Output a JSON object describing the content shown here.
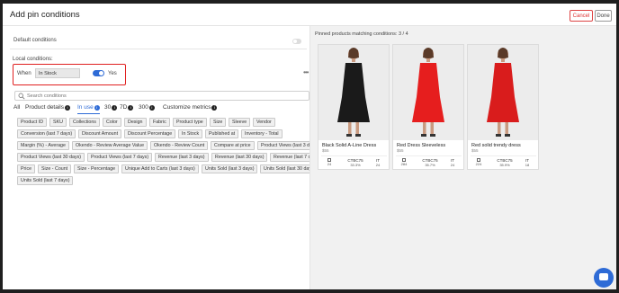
{
  "header": {
    "title": "Add pin conditions",
    "cancel": "Cancel",
    "done": "Done"
  },
  "left": {
    "default_conditions": "Default conditions",
    "local_conditions": "Local conditions:",
    "when_label": "When",
    "when_value": "In Stock",
    "yes_label": "Yes",
    "more": "•••",
    "search_placeholder": "Search conditions"
  },
  "tabs": [
    {
      "label": "All"
    },
    {
      "label": "Product details",
      "info": "i"
    },
    {
      "label": "In use",
      "info": "i",
      "active": true
    },
    {
      "label": "30",
      "info": "i"
    },
    {
      "label": "7D",
      "info": "i"
    },
    {
      "label": "300",
      "info": "i"
    },
    {
      "label": "Customize metrics",
      "info": "i"
    }
  ],
  "chips": [
    [
      "Product ID",
      "SKU",
      "Collections",
      "Color",
      "Design",
      "Fabric",
      "Product type",
      "Size",
      "Sleeve",
      "Vendor"
    ],
    [
      "Conversion (last 7 days)",
      "Discount Amount",
      "Discount Percentage",
      "In Stock",
      "Published at",
      "Inventory - Total"
    ],
    [
      "Margin (%) - Average",
      "Okendo - Review Average Value",
      "Okendo - Review Count",
      "Compare at price",
      "Product Views (last 3 days)"
    ],
    [
      "Product Views (last 30 days)",
      "Product Views (last 7 days)",
      "Revenue (last 3 days)",
      "Revenue (last 30 days)",
      "Revenue (last 7 days)"
    ],
    [
      "Price",
      "Size - Count",
      "Size - Percentage",
      "Unique Add to Carts (last 3 days)",
      "Units Sold (last 3 days)",
      "Units Sold (last 30 days)"
    ],
    [
      "Units Sold (last 7 days)"
    ]
  ],
  "right": {
    "pinned_label": "Pinned products matching conditions: 3 / 4",
    "products": [
      {
        "name": "Black Solid A-Line Dress",
        "price": "$55",
        "stock": "24",
        "ctr_label": "CTBC75",
        "ctr_value": "33.3%",
        "it_label": "IT",
        "it_value": "24",
        "dress_color": "#1a1a1a"
      },
      {
        "name": "Red Dress Sleeveless",
        "price": "$55",
        "stock": "284",
        "ctr_label": "CTBC75",
        "ctr_value": "35.7%",
        "it_label": "IT",
        "it_value": "24",
        "dress_color": "#e61e1e"
      },
      {
        "name": "Red solid trendy dress",
        "price": "$55",
        "stock": "224",
        "ctr_label": "CTBC75",
        "ctr_value": "35.9%",
        "it_label": "IT",
        "it_value": "18",
        "dress_color": "#d91c1c"
      }
    ]
  },
  "colors": {
    "accent": "#2e6bd6",
    "highlight": "#e02020",
    "cancel": "#d33333"
  }
}
